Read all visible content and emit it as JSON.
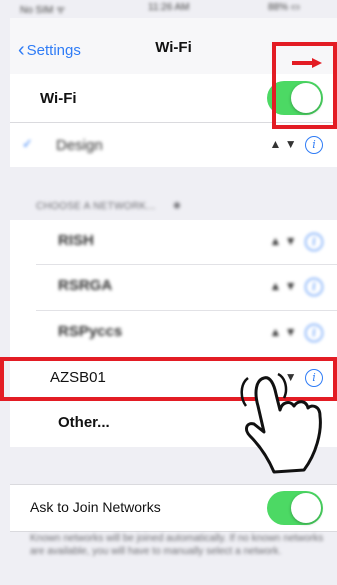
{
  "status_bar": {
    "carrier": "No SIM ᯤ",
    "time": "11:26 AM",
    "battery": "88% ▭"
  },
  "nav": {
    "back_label": "Settings",
    "title": "Wi-Fi"
  },
  "wifi_toggle": {
    "label": "Wi-Fi",
    "on": true
  },
  "connected_network": {
    "name": "Design"
  },
  "choose_network": {
    "header": "CHOOSE A NETWORK..."
  },
  "networks": [
    {
      "name": "RISH"
    },
    {
      "name": "RSRGA"
    },
    {
      "name": "RSPyccs"
    },
    {
      "name": "AZSB01"
    }
  ],
  "other": {
    "label": "Other..."
  },
  "ask_to_join": {
    "label": "Ask to Join Networks",
    "on": true
  },
  "note": "Known networks will be joined automatically. If no known networks are available, you will have to manually select a network.",
  "icons": {
    "lock": "🔒",
    "wifi": "ᯤ",
    "info": "i"
  },
  "colors": {
    "accent": "#2f7cf6",
    "toggle_on": "#4cd964",
    "highlight": "#e31c24"
  }
}
